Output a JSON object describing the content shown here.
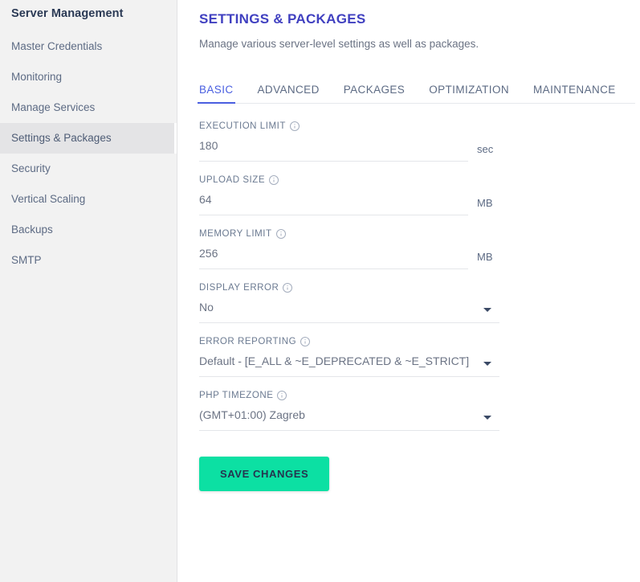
{
  "sidebar": {
    "title": "Server Management",
    "items": [
      {
        "label": "Master Credentials",
        "active": false
      },
      {
        "label": "Monitoring",
        "active": false
      },
      {
        "label": "Manage Services",
        "active": false
      },
      {
        "label": "Settings & Packages",
        "active": true
      },
      {
        "label": "Security",
        "active": false
      },
      {
        "label": "Vertical Scaling",
        "active": false
      },
      {
        "label": "Backups",
        "active": false
      },
      {
        "label": "SMTP",
        "active": false
      }
    ]
  },
  "header": {
    "title": "SETTINGS & PACKAGES",
    "subtitle": "Manage various server-level settings as well as packages."
  },
  "tabs": [
    {
      "label": "BASIC",
      "active": true
    },
    {
      "label": "ADVANCED",
      "active": false
    },
    {
      "label": "PACKAGES",
      "active": false
    },
    {
      "label": "OPTIMIZATION",
      "active": false
    },
    {
      "label": "MAINTENANCE",
      "active": false
    }
  ],
  "form": {
    "execution_limit": {
      "label": "EXECUTION LIMIT",
      "value": "180",
      "unit": "sec"
    },
    "upload_size": {
      "label": "UPLOAD SIZE",
      "value": "64",
      "unit": "MB"
    },
    "memory_limit": {
      "label": "MEMORY LIMIT",
      "value": "256",
      "unit": "MB"
    },
    "display_error": {
      "label": "DISPLAY ERROR",
      "value": "No"
    },
    "error_reporting": {
      "label": "ERROR REPORTING",
      "value": "Default - [E_ALL & ~E_DEPRECATED & ~E_STRICT]"
    },
    "php_timezone": {
      "label": "PHP TIMEZONE",
      "value": "(GMT+01:00) Zagreb"
    },
    "save_label": "SAVE CHANGES"
  },
  "colors": {
    "title": "#4040c0",
    "tab_active": "#4a5fe0",
    "save_bg": "#0ce0a3",
    "save_text": "#25344f",
    "sidebar_bg": "#f2f2f2"
  }
}
